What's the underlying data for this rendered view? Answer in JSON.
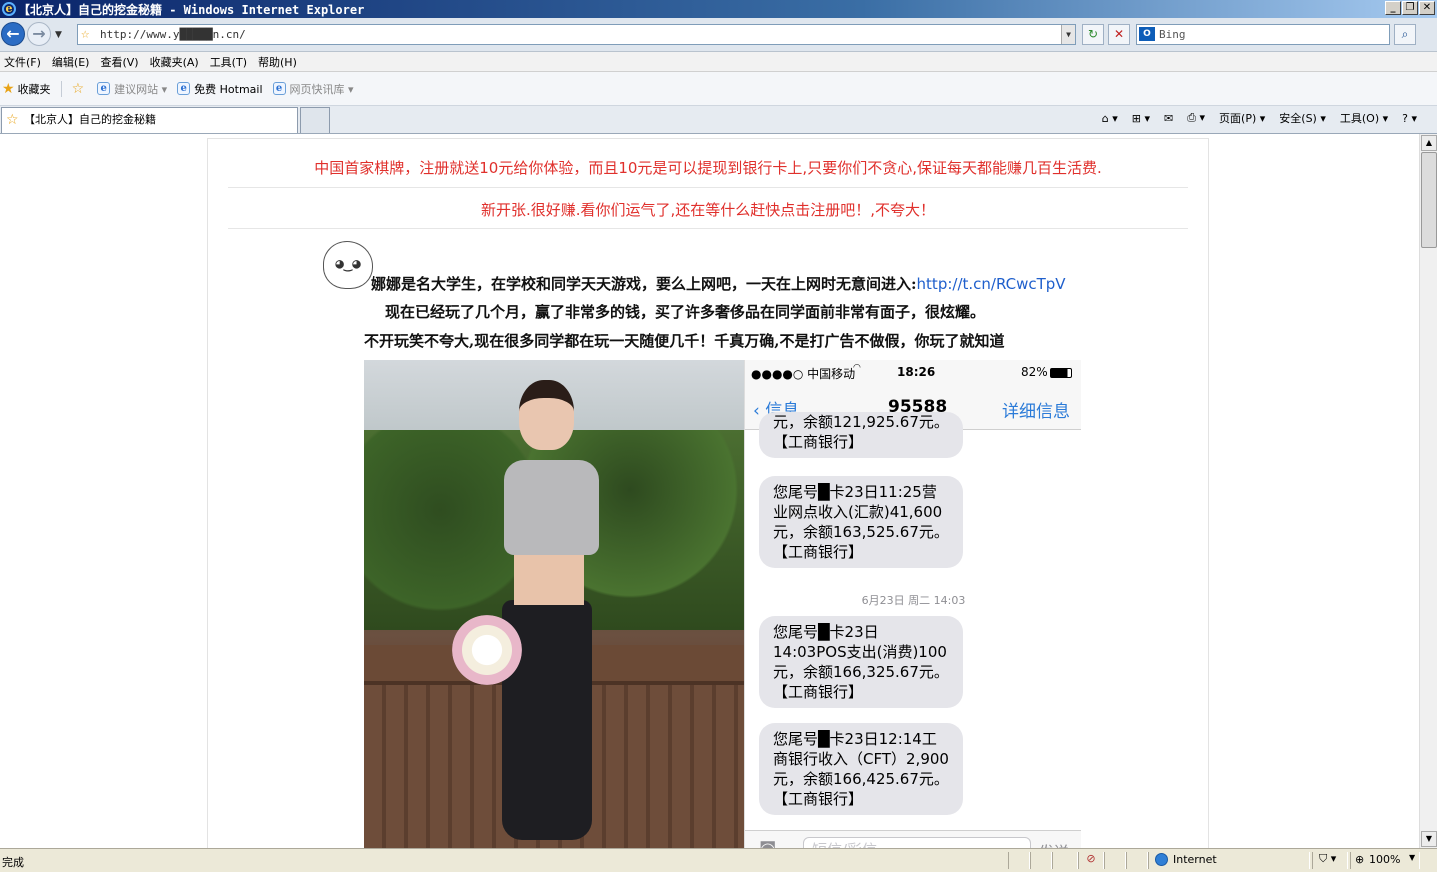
{
  "window": {
    "title": "【北京人】自己的挖金秘籍 - Windows Internet Explorer",
    "min_label": "_",
    "max_label": "❐",
    "close_label": "✕"
  },
  "address": {
    "url": "http://www.y█████n.cn/",
    "refresh_icon": "↻",
    "stop_icon": "✕",
    "search_placeholder": "Bing",
    "search_provider_label": "O",
    "search_go_icon": "⌕"
  },
  "menu": [
    "文件(F)",
    "编辑(E)",
    "查看(V)",
    "收藏夹(A)",
    "工具(T)",
    "帮助(H)"
  ],
  "favorites": {
    "label": "收藏夹",
    "items": [
      "建议网站 ▾",
      "免费 Hotmail",
      "网页快讯库 ▾"
    ]
  },
  "tab": {
    "title": "【北京人】自己的挖金秘籍"
  },
  "commands": [
    "⌂ ▾",
    "⊞ ▾",
    "✉",
    "⎙ ▾",
    "页面(P) ▾",
    "安全(S) ▾",
    "工具(O) ▾",
    "? ▾"
  ],
  "page": {
    "banner1": "中国首家棋牌，注册就送10元给你体验，而且10元是可以提现到银行卡上,只要你们不贪心,保证每天都能赚几百生活费.",
    "banner2": "新开张.很好赚.看你们运气了,还在等什么赶快点击注册吧！,不夸大！",
    "face": "◕‿◕",
    "para1_text": "娜娜是名大学生，在学校和同学天天游戏，要么上网吧，一天在上网时无意间进入:",
    "para1_link": "http://t.cn/RCwcTpV",
    "para2": "现在已经玩了几个月，赢了非常多的钱，买了许多奢侈品在同学面前非常有面子，很炫耀。",
    "para3": "不开玩笑不夸大,现在很多同学都在玩一天随便几千！千真万确,不是打广告不做假，你玩了就知道"
  },
  "sms": {
    "carrier": "●●●●○ 中国移动",
    "time": "18:26",
    "battery": "82%",
    "back_label": "信息",
    "contact": "95588",
    "details_label": "详细信息",
    "msg0": "元，余额121,925.67元。\n【工商银行】",
    "msg1": "您尾号█卡23日11:25营\n业网点收入(汇款)41,600\n元，余额163,525.67元。\n【工商银行】",
    "date": "6月23日 周二 14:03",
    "msg2": "您尾号█卡23日\n14:03POS支出(消费)100\n元，余额166,325.67元。\n【工商银行】",
    "msg3": "您尾号█卡23日12:14工\n商银行收入（CFT）2,900\n元，余额166,425.67元。\n【工商银行】",
    "input_placeholder": "短信/彩信",
    "send_label": "发送"
  },
  "status": {
    "text": "完成",
    "zone": "Internet",
    "zoom": "100%"
  },
  "colors": {
    "title_bar": "#0a246a",
    "banner_red": "#e0302c",
    "link_blue": "#1f5fcc",
    "ios_blue": "#2b7bd8"
  }
}
